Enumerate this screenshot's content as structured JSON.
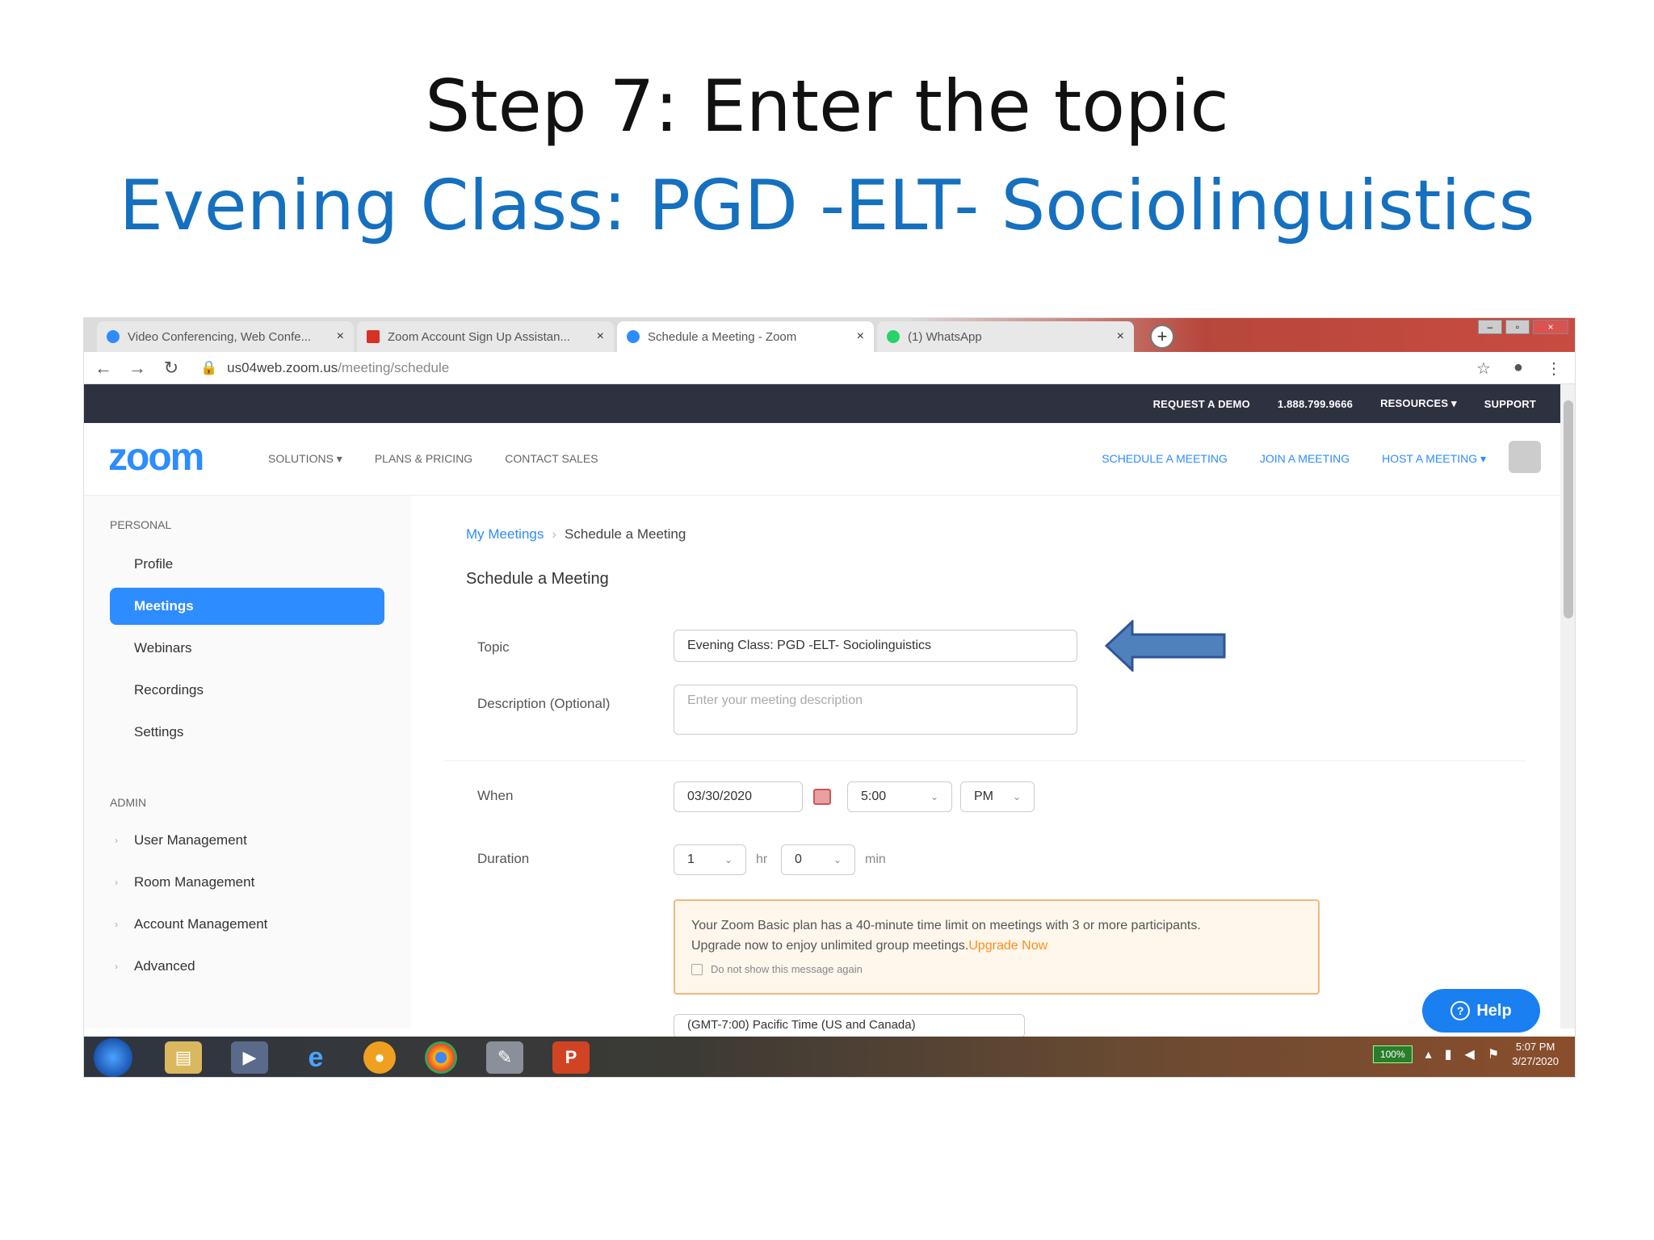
{
  "slide": {
    "title": "Step 7: Enter the topic",
    "subtitle": "Evening Class: PGD -ELT- Sociolinguistics"
  },
  "browser": {
    "tabs": [
      {
        "label": "Video Conferencing, Web Confe...",
        "icon": "zoom-tab-icon",
        "color": "#2d8cff"
      },
      {
        "label": "Zoom Account Sign Up Assistan...",
        "icon": "gmail-tab-icon",
        "color": "#d93025"
      },
      {
        "label": "Schedule a Meeting - Zoom",
        "icon": "zoom-tab-icon",
        "color": "#2d8cff"
      },
      {
        "label": "(1) WhatsApp",
        "icon": "whatsapp-tab-icon",
        "color": "#25d366"
      }
    ],
    "close_glyph": "×",
    "new_tab_glyph": "+",
    "url_host": "us04web.zoom.us",
    "url_path": "/meeting/schedule"
  },
  "zoom": {
    "topbar": [
      "REQUEST A DEMO",
      "1.888.799.9666",
      "RESOURCES ▾",
      "SUPPORT"
    ],
    "logo": "zoom",
    "nav_left": [
      "SOLUTIONS ▾",
      "PLANS & PRICING",
      "CONTACT SALES"
    ],
    "nav_right": [
      "SCHEDULE A MEETING",
      "JOIN A MEETING",
      "HOST A MEETING ▾"
    ],
    "brand_color": "#2d8cff"
  },
  "sidebar": {
    "personal_heading": "PERSONAL",
    "personal_items": [
      "Profile",
      "Meetings",
      "Webinars",
      "Recordings",
      "Settings"
    ],
    "admin_heading": "ADMIN",
    "admin_items": [
      "User Management",
      "Room Management",
      "Account Management",
      "Advanced"
    ]
  },
  "main": {
    "breadcrumb_link": "My Meetings",
    "breadcrumb_sep": "›",
    "breadcrumb_current": "Schedule a Meeting",
    "page_title": "Schedule a Meeting",
    "topic_label": "Topic",
    "topic_value": "Evening Class: PGD -ELT- Sociolinguistics",
    "description_label": "Description (Optional)",
    "description_placeholder": "Enter your meeting description",
    "when_label": "When",
    "date_value": "03/30/2020",
    "time_value": "5:00",
    "ampm_value": "PM",
    "duration_label": "Duration",
    "duration_hr": "1",
    "hr_unit": "hr",
    "duration_min": "0",
    "min_unit": "min",
    "notice_line1": "Your Zoom Basic plan has a 40-minute time limit on meetings with 3 or more participants.",
    "notice_line2": "Upgrade now to enjoy unlimited group meetings.",
    "upgrade_link": "Upgrade Now",
    "dont_show": "Do not show this message again",
    "timezone_value": "(GMT-7:00) Pacific Time (US and Canada)",
    "help_label": "Help"
  },
  "taskbar": {
    "battery": "100%",
    "time": "5:07 PM",
    "date": "3/27/2020"
  }
}
